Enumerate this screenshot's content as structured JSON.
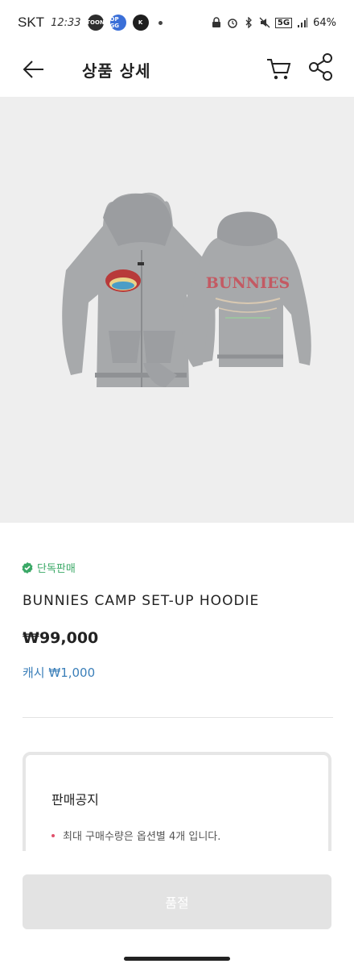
{
  "status_bar": {
    "carrier": "SKT",
    "time": "12:33",
    "apps": [
      "TOON",
      "OP GG",
      "K"
    ],
    "battery": "64%",
    "network": "5G"
  },
  "header": {
    "title": "상품 상세"
  },
  "product": {
    "badge": "단독판매",
    "name": "BUNNIES CAMP SET-UP HOODIE",
    "price": "₩99,000",
    "cash": "캐시 ₩1,000",
    "image_text": "BUNNIES"
  },
  "notice": {
    "title": "판매공지",
    "items": [
      "최대 구매수량은 옵션별 4개 입니다."
    ]
  },
  "cta": {
    "label": "품절"
  },
  "colors": {
    "badge_green": "#3aa866",
    "cash_blue": "#3b7fb9",
    "bullet_pink": "#e0506b",
    "button_disabled": "#e3e3e3"
  }
}
